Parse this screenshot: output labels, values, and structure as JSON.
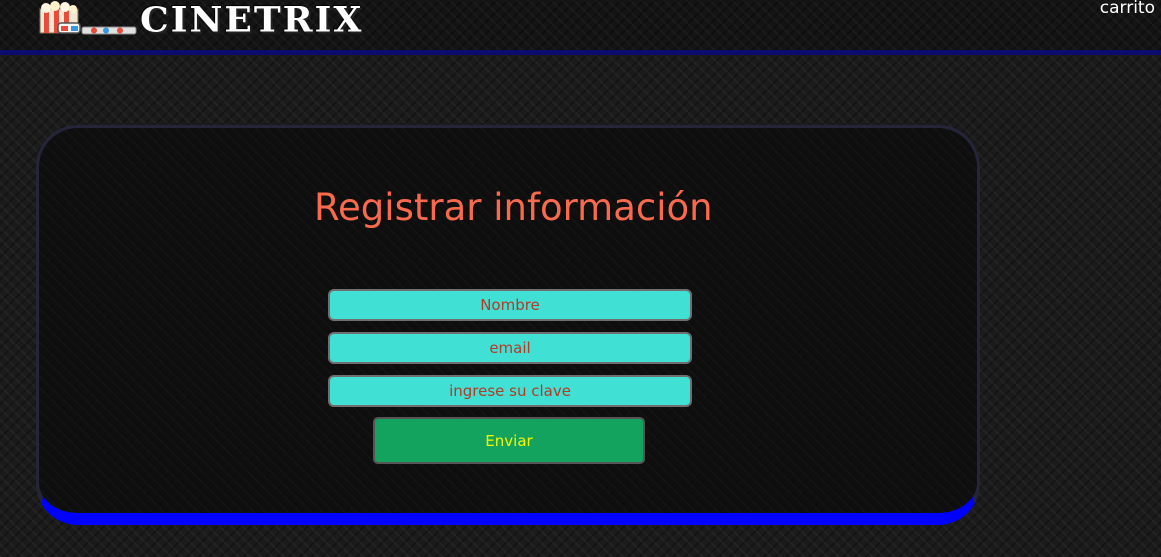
{
  "header": {
    "brand_name": "CINETRIX",
    "logo_icon": "popcorn-3d-glasses-icon",
    "cart_link": "carrito"
  },
  "form": {
    "title": "Registrar información",
    "fields": {
      "name_placeholder": "Nombre",
      "email_placeholder": "email",
      "password_placeholder": "ingrese su clave"
    },
    "submit_label": "Enviar"
  },
  "colors": {
    "title": "#f8694d",
    "input_background": "#40e0d4",
    "input_text": "#c0392b",
    "button_background": "#13a35e",
    "button_text": "#f4f800",
    "card_bottom_border": "#0000ff",
    "header_line": "#0c0c6e"
  }
}
